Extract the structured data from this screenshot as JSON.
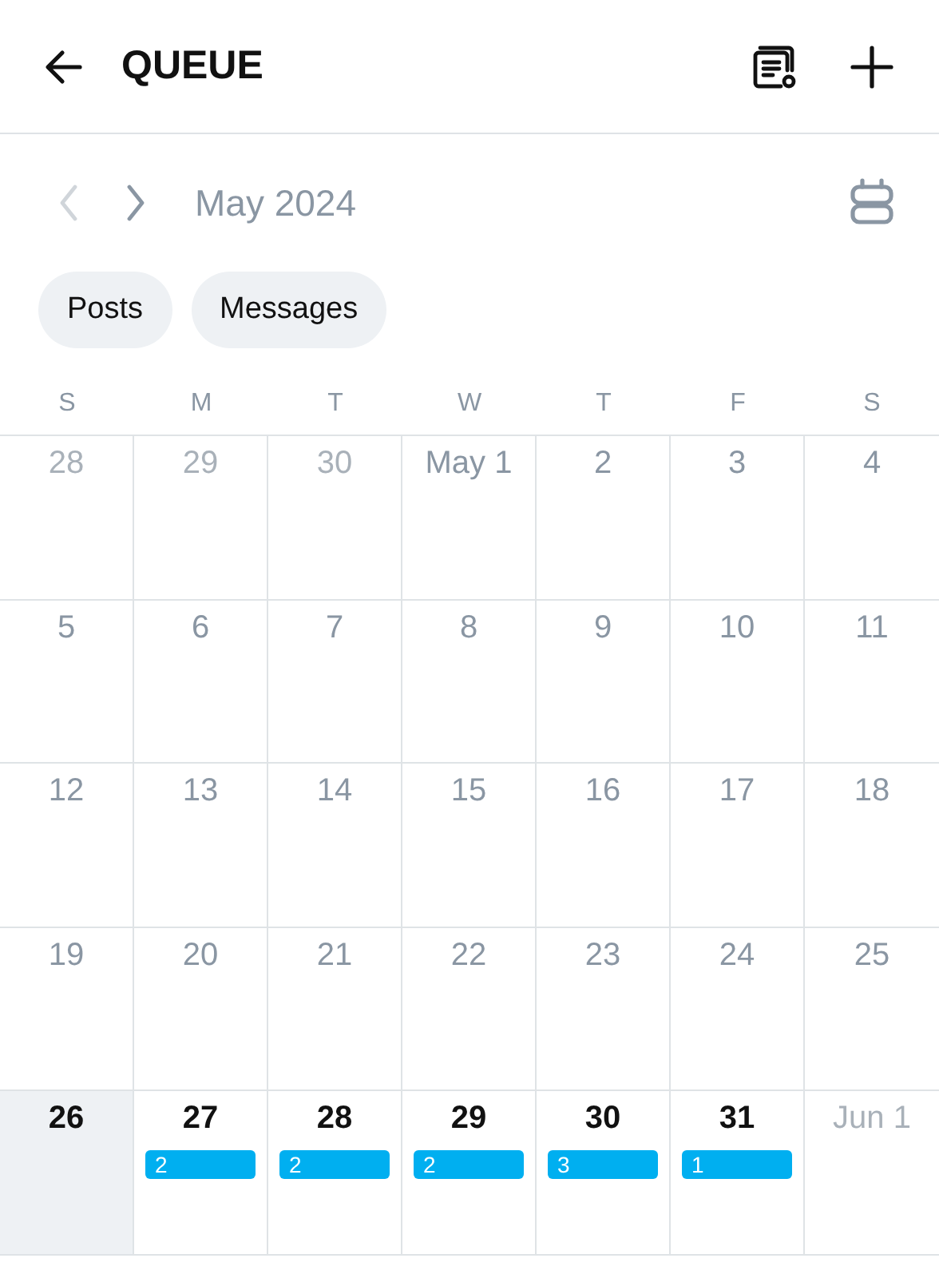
{
  "header": {
    "title": "QUEUE"
  },
  "month_bar": {
    "label": "May 2024",
    "prev_disabled": true
  },
  "filters": [
    {
      "label": "Posts"
    },
    {
      "label": "Messages"
    }
  ],
  "weekdays": [
    "S",
    "M",
    "T",
    "W",
    "T",
    "F",
    "S"
  ],
  "days": [
    {
      "label": "28",
      "kind": "outside",
      "selected": false
    },
    {
      "label": "29",
      "kind": "outside",
      "selected": false
    },
    {
      "label": "30",
      "kind": "outside",
      "selected": false
    },
    {
      "label": "May 1",
      "kind": "past",
      "selected": false
    },
    {
      "label": "2",
      "kind": "past",
      "selected": false
    },
    {
      "label": "3",
      "kind": "past",
      "selected": false
    },
    {
      "label": "4",
      "kind": "past",
      "selected": false
    },
    {
      "label": "5",
      "kind": "past",
      "selected": false
    },
    {
      "label": "6",
      "kind": "past",
      "selected": false
    },
    {
      "label": "7",
      "kind": "past",
      "selected": false
    },
    {
      "label": "8",
      "kind": "past",
      "selected": false
    },
    {
      "label": "9",
      "kind": "past",
      "selected": false
    },
    {
      "label": "10",
      "kind": "past",
      "selected": false
    },
    {
      "label": "11",
      "kind": "past",
      "selected": false
    },
    {
      "label": "12",
      "kind": "past",
      "selected": false
    },
    {
      "label": "13",
      "kind": "past",
      "selected": false
    },
    {
      "label": "14",
      "kind": "past",
      "selected": false
    },
    {
      "label": "15",
      "kind": "past",
      "selected": false
    },
    {
      "label": "16",
      "kind": "past",
      "selected": false
    },
    {
      "label": "17",
      "kind": "past",
      "selected": false
    },
    {
      "label": "18",
      "kind": "past",
      "selected": false
    },
    {
      "label": "19",
      "kind": "past",
      "selected": false
    },
    {
      "label": "20",
      "kind": "past",
      "selected": false
    },
    {
      "label": "21",
      "kind": "past",
      "selected": false
    },
    {
      "label": "22",
      "kind": "past",
      "selected": false
    },
    {
      "label": "23",
      "kind": "past",
      "selected": false
    },
    {
      "label": "24",
      "kind": "past",
      "selected": false
    },
    {
      "label": "25",
      "kind": "past",
      "selected": false
    },
    {
      "label": "26",
      "kind": "upcoming",
      "selected": true
    },
    {
      "label": "27",
      "kind": "upcoming",
      "selected": false,
      "count": "2"
    },
    {
      "label": "28",
      "kind": "upcoming",
      "selected": false,
      "count": "2"
    },
    {
      "label": "29",
      "kind": "upcoming",
      "selected": false,
      "count": "2"
    },
    {
      "label": "30",
      "kind": "upcoming",
      "selected": false,
      "count": "3"
    },
    {
      "label": "31",
      "kind": "upcoming",
      "selected": false,
      "count": "1"
    },
    {
      "label": "Jun 1",
      "kind": "outside",
      "selected": false
    }
  ]
}
